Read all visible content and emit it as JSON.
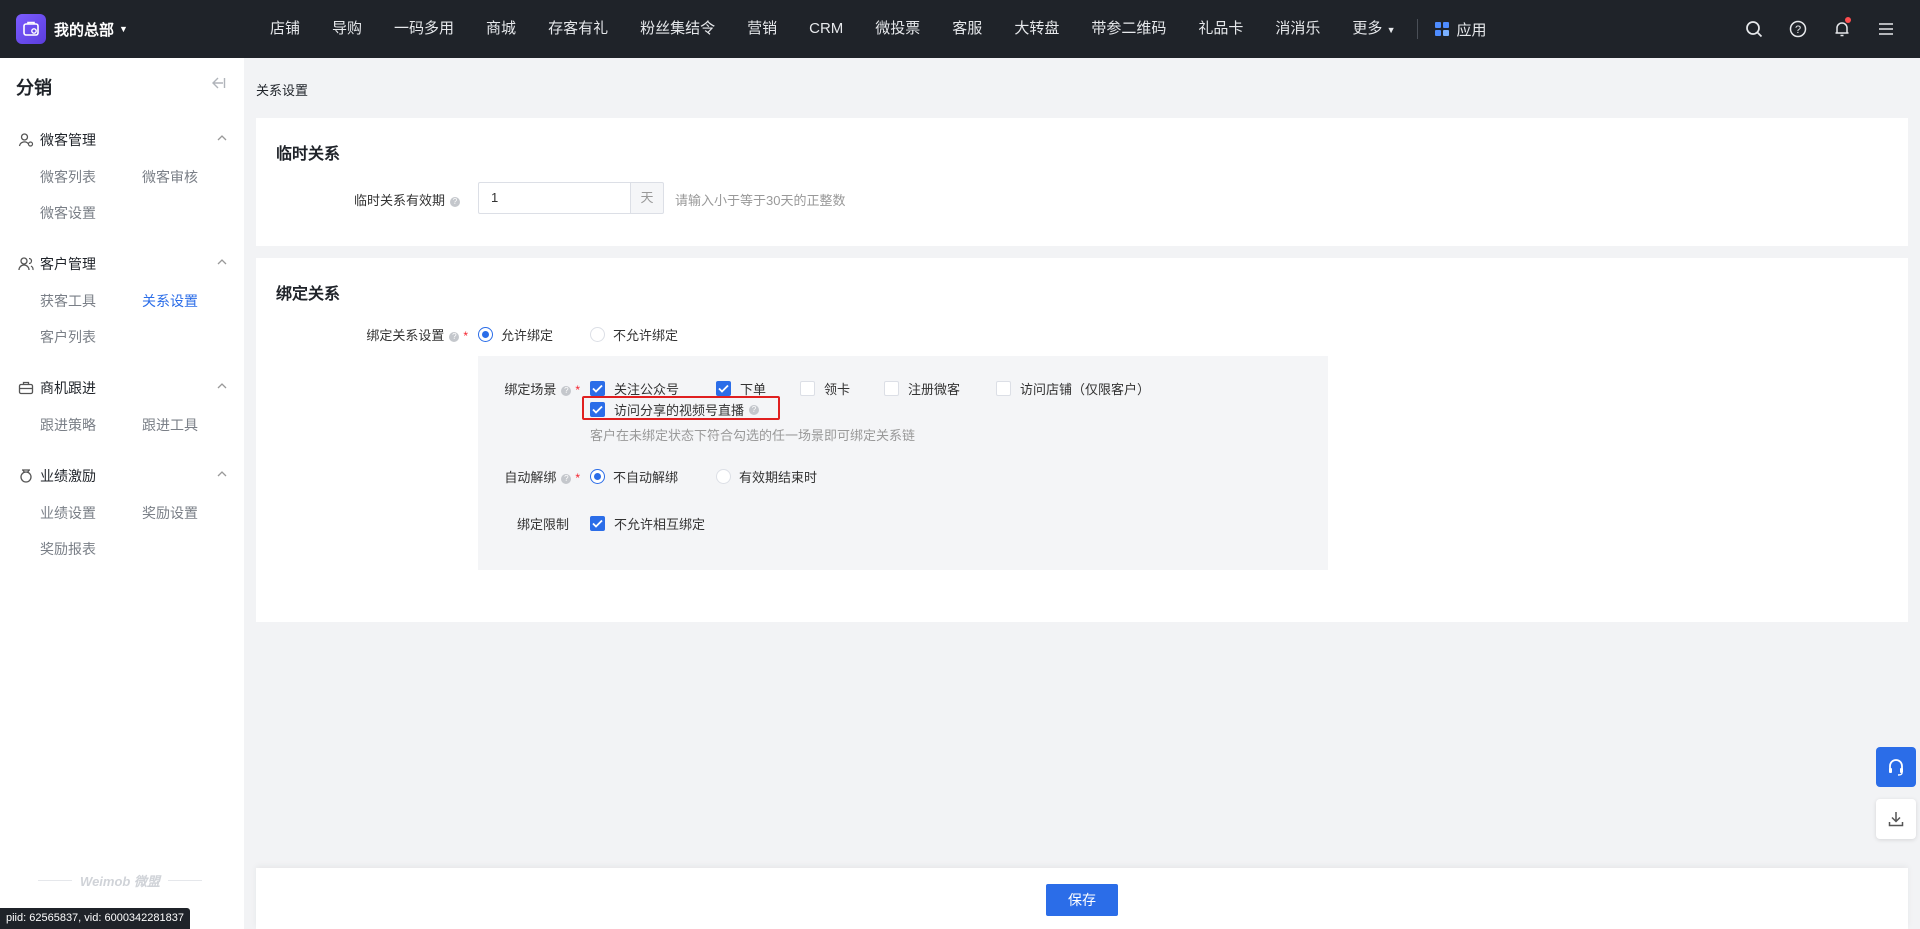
{
  "brand": {
    "name": "我的总部"
  },
  "nav": {
    "items": [
      "店铺",
      "导购",
      "一码多用",
      "商城",
      "存客有礼",
      "粉丝集结令",
      "营销",
      "CRM",
      "微投票",
      "客服",
      "大转盘",
      "带参二维码",
      "礼品卡",
      "消消乐"
    ],
    "more_label": "更多",
    "app_label": "应用"
  },
  "sidebar": {
    "title": "分销",
    "groups": [
      {
        "label": "微客管理",
        "items": [
          "微客列表",
          "微客审核",
          "微客设置"
        ]
      },
      {
        "label": "客户管理",
        "items": [
          "获客工具",
          "关系设置",
          "客户列表"
        ]
      },
      {
        "label": "商机跟进",
        "items": [
          "跟进策略",
          "跟进工具"
        ]
      },
      {
        "label": "业绩激励",
        "items": [
          "业绩设置",
          "奖励设置",
          "奖励报表"
        ]
      }
    ],
    "active_item": "关系设置",
    "footer_logo": "Weimob 微盟"
  },
  "breadcrumb": "关系设置",
  "temp_relation": {
    "title": "临时关系",
    "validity_label": "临时关系有效期",
    "validity_value": "1",
    "validity_unit": "天",
    "validity_hint": "请输入小于等于30天的正整数"
  },
  "bind_relation": {
    "title": "绑定关系",
    "setting_label": "绑定关系设置",
    "options": [
      "允许绑定",
      "不允许绑定"
    ],
    "selected": "允许绑定",
    "scene_label": "绑定场景",
    "scenes": [
      {
        "label": "关注公众号",
        "checked": true
      },
      {
        "label": "下单",
        "checked": true
      },
      {
        "label": "领卡",
        "checked": false
      },
      {
        "label": "注册微客",
        "checked": false
      },
      {
        "label": "访问店铺（仅限客户）",
        "checked": false
      },
      {
        "label": "访问分享的视频号直播",
        "checked": true
      }
    ],
    "scene_hint": "客户在未绑定状态下符合勾选的任一场景即可绑定关系链",
    "auto_unbind_label": "自动解绑",
    "auto_unbind_options": [
      "不自动解绑",
      "有效期结束时"
    ],
    "auto_unbind_selected": "不自动解绑",
    "limit_label": "绑定限制",
    "limit_option": "不允许相互绑定",
    "limit_checked": true
  },
  "footer": {
    "save_label": "保存"
  },
  "debug": "piid: 62565837, vid: 6000342281837",
  "colors": {
    "primary": "#2b6de8",
    "nav_bg": "#1f2329",
    "highlight": "#e02020"
  }
}
